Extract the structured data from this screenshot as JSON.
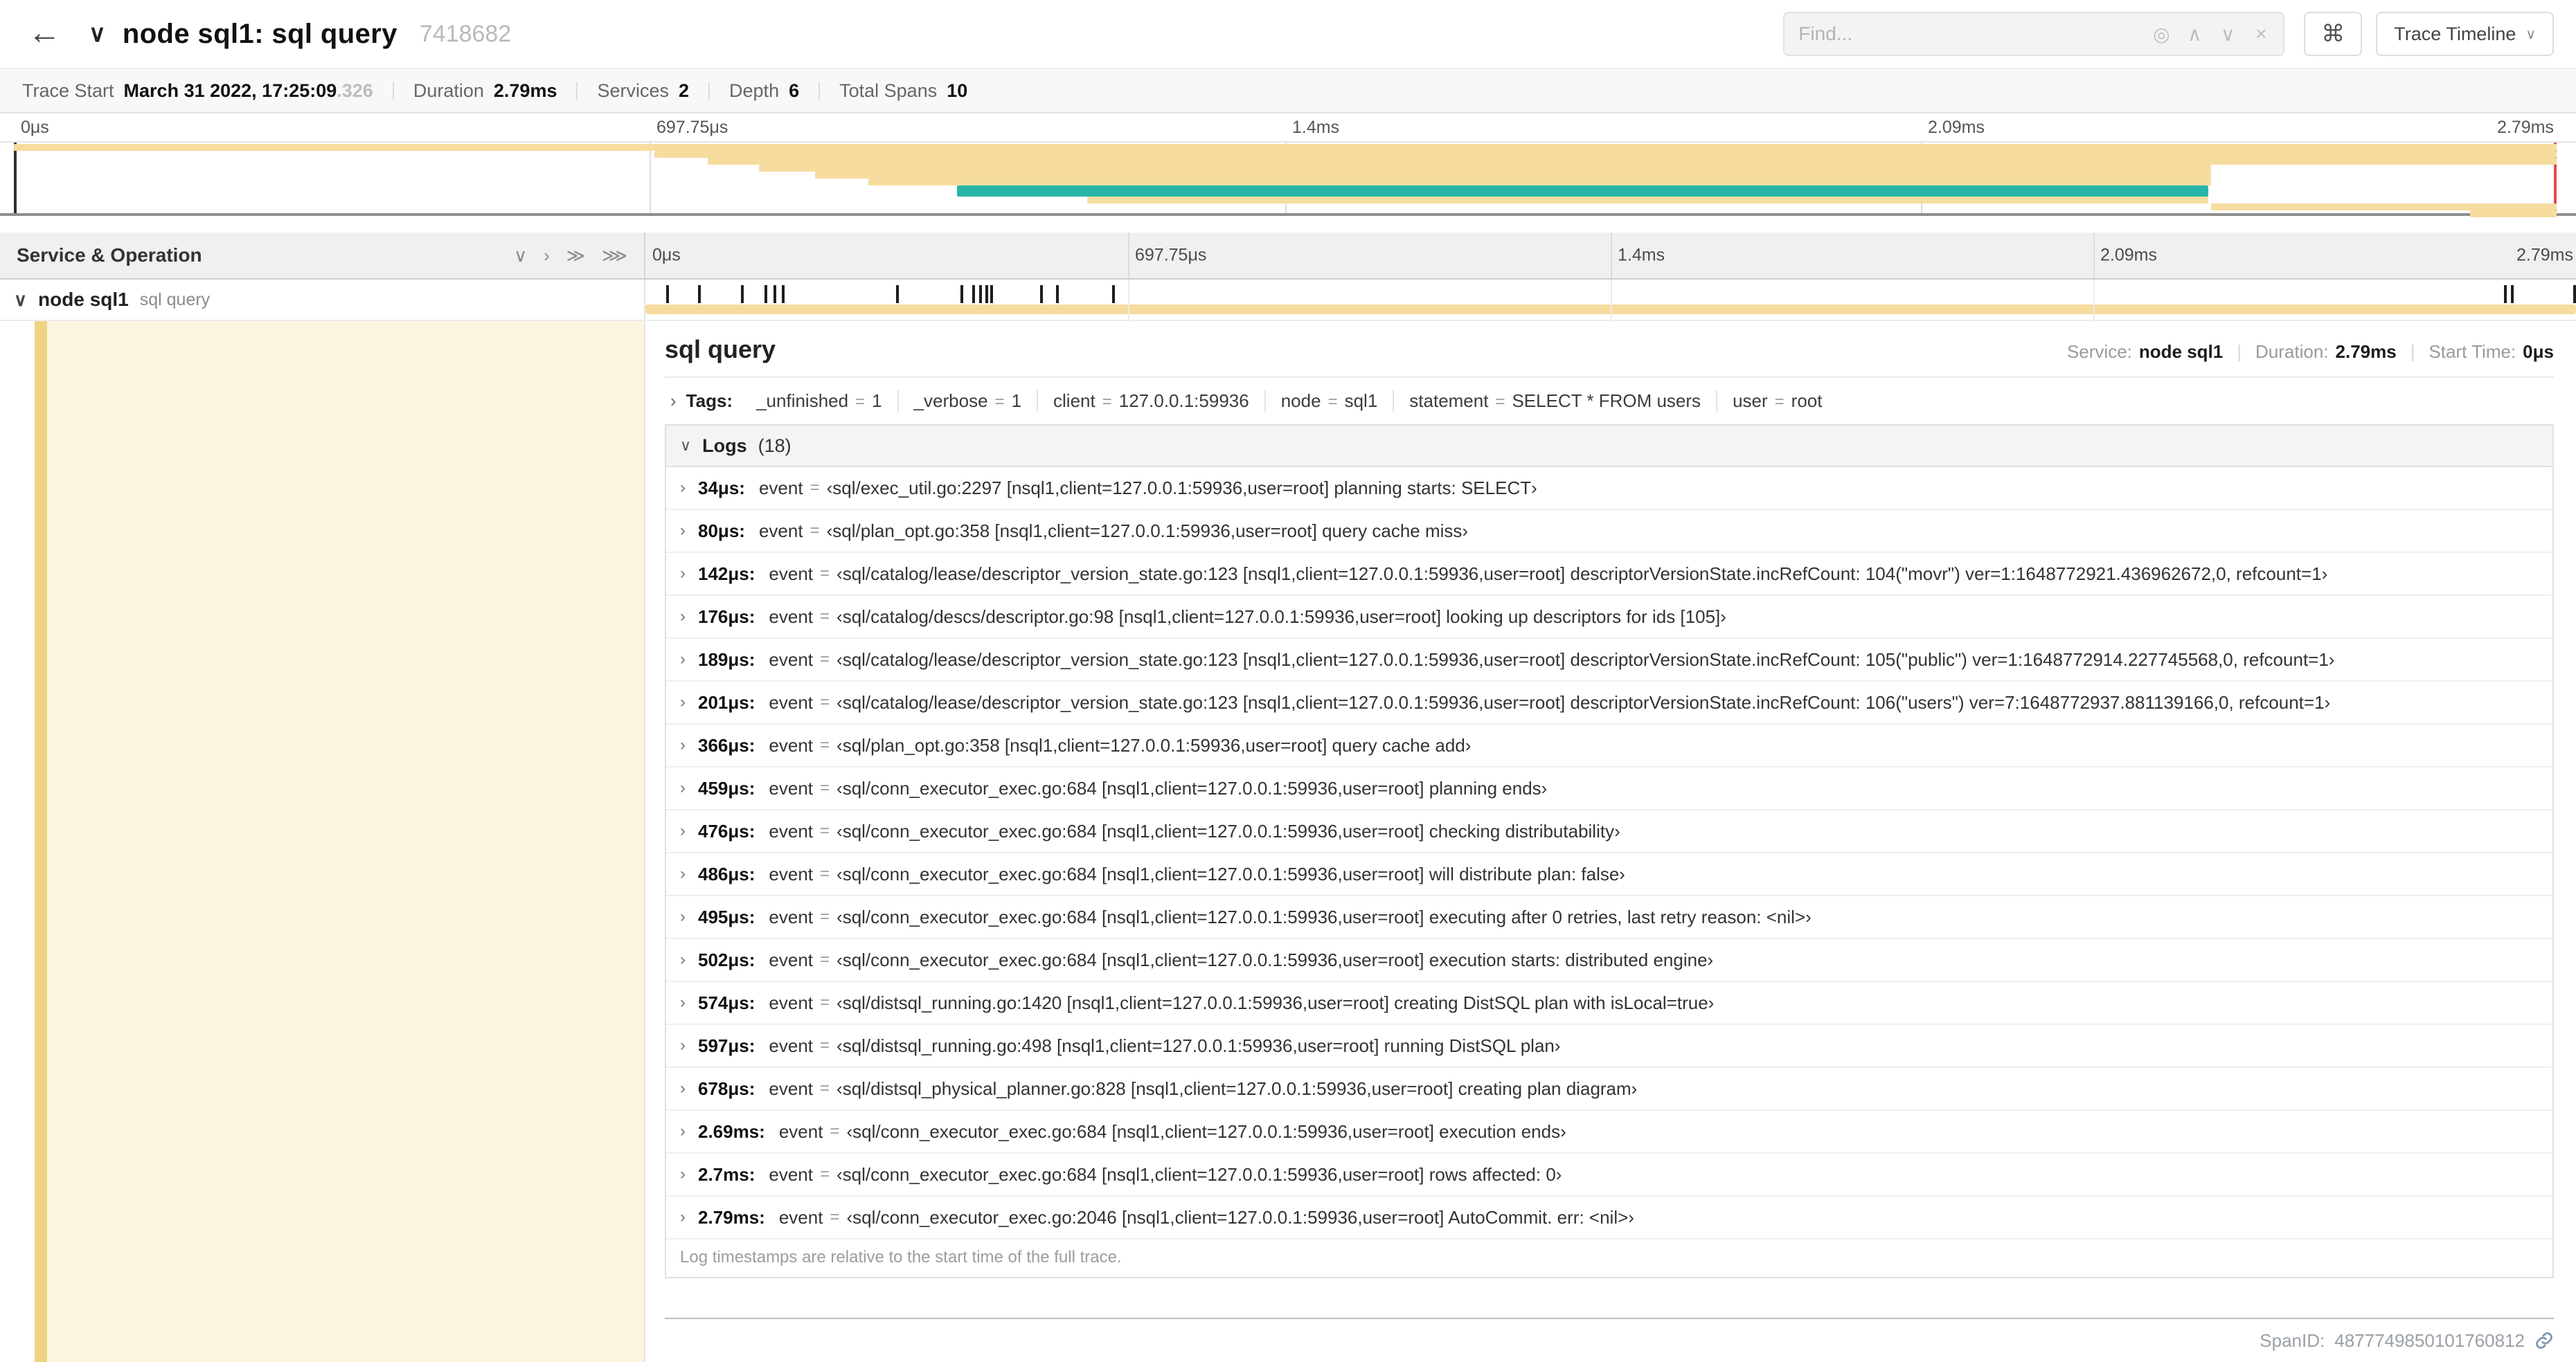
{
  "icons": {
    "back": "←",
    "chevron_down": "∨",
    "chevron_up": "∧",
    "chevron_right": "›",
    "double_chevron_right": "≫",
    "triple_chevron_right": "⋙",
    "locate": "◎",
    "close": "×",
    "command": "⌘"
  },
  "header": {
    "title": "node sql1: sql query",
    "trace_id_short": "7418682",
    "find_placeholder": "Find...",
    "view_button_label": "Trace Timeline"
  },
  "summary": {
    "items": [
      {
        "label": "Trace Start",
        "value": "March 31 2022, 17:25:09",
        "suffix": ".326"
      },
      {
        "label": "Duration",
        "value": "2.79ms"
      },
      {
        "label": "Services",
        "value": "2"
      },
      {
        "label": "Depth",
        "value": "6"
      },
      {
        "label": "Total Spans",
        "value": "10"
      }
    ]
  },
  "minimap": {
    "axis_labels": [
      "0μs",
      "697.75μs",
      "1.4ms",
      "2.09ms",
      "2.79ms"
    ],
    "colors": {
      "tan": "#f7dca0",
      "teal": "#26b5a8",
      "scrubber": "#e5484d"
    },
    "bars": [
      {
        "start": 0,
        "end": 100,
        "color": "tan"
      },
      {
        "start": 25.2,
        "end": 100,
        "color": "tan"
      },
      {
        "start": 27.3,
        "end": 100,
        "color": "tan"
      },
      {
        "start": 29.3,
        "end": 86.4,
        "color": "tan"
      },
      {
        "start": 31.5,
        "end": 86.4,
        "color": "tan"
      },
      {
        "start": 33.6,
        "end": 86.4,
        "color": "tan"
      },
      {
        "start": 37.1,
        "end": 86.3,
        "color": "teal"
      },
      {
        "start": 42.2,
        "end": 86.3,
        "color": "tan"
      },
      {
        "start": 86.4,
        "end": 100,
        "color": "tan"
      },
      {
        "start": 96.6,
        "end": 100,
        "color": "tan"
      }
    ]
  },
  "timeline": {
    "left_header": "Service & Operation",
    "ruler_labels": [
      "0μs",
      "697.75μs",
      "1.4ms",
      "2.09ms",
      "2.79ms"
    ],
    "duration_us": 2790,
    "row": {
      "service": "node sql1",
      "operation": "sql query",
      "bar_start_pct": 0,
      "bar_end_pct": 100
    }
  },
  "detail": {
    "title": "sql query",
    "service_label": "Service:",
    "service_value": "node sql1",
    "duration_label": "Duration:",
    "duration_value": "2.79ms",
    "start_label": "Start Time:",
    "start_value": "0μs",
    "tags_label": "Tags:",
    "tag_eq": "=",
    "tags": [
      {
        "key": "_unfinished",
        "value": "1"
      },
      {
        "key": "_verbose",
        "value": "1"
      },
      {
        "key": "client",
        "value": "127.0.0.1:59936"
      },
      {
        "key": "node",
        "value": "sql1"
      },
      {
        "key": "statement",
        "value": "SELECT * FROM users"
      },
      {
        "key": "user",
        "value": "root"
      }
    ],
    "logs_label": "Logs",
    "logs_count": "(18)",
    "logs": [
      {
        "time": "34μs:",
        "time_us": 34,
        "key": "event",
        "message": "‹sql/exec_util.go:2297 [nsql1,client=127.0.0.1:59936,user=root] planning starts: SELECT›"
      },
      {
        "time": "80μs:",
        "time_us": 80,
        "key": "event",
        "message": "‹sql/plan_opt.go:358 [nsql1,client=127.0.0.1:59936,user=root] query cache miss›"
      },
      {
        "time": "142μs:",
        "time_us": 142,
        "key": "event",
        "message": "‹sql/catalog/lease/descriptor_version_state.go:123 [nsql1,client=127.0.0.1:59936,user=root] descriptorVersionState.incRefCount: 104(\"movr\") ver=1:1648772921.436962672,0, refcount=1›"
      },
      {
        "time": "176μs:",
        "time_us": 176,
        "key": "event",
        "message": "‹sql/catalog/descs/descriptor.go:98 [nsql1,client=127.0.0.1:59936,user=root] looking up descriptors for ids [105]›"
      },
      {
        "time": "189μs:",
        "time_us": 189,
        "key": "event",
        "message": "‹sql/catalog/lease/descriptor_version_state.go:123 [nsql1,client=127.0.0.1:59936,user=root] descriptorVersionState.incRefCount: 105(\"public\") ver=1:1648772914.227745568,0, refcount=1›"
      },
      {
        "time": "201μs:",
        "time_us": 201,
        "key": "event",
        "message": "‹sql/catalog/lease/descriptor_version_state.go:123 [nsql1,client=127.0.0.1:59936,user=root] descriptorVersionState.incRefCount: 106(\"users\") ver=7:1648772937.881139166,0, refcount=1›"
      },
      {
        "time": "366μs:",
        "time_us": 366,
        "key": "event",
        "message": "‹sql/plan_opt.go:358 [nsql1,client=127.0.0.1:59936,user=root] query cache add›"
      },
      {
        "time": "459μs:",
        "time_us": 459,
        "key": "event",
        "message": "‹sql/conn_executor_exec.go:684 [nsql1,client=127.0.0.1:59936,user=root] planning ends›"
      },
      {
        "time": "476μs:",
        "time_us": 476,
        "key": "event",
        "message": "‹sql/conn_executor_exec.go:684 [nsql1,client=127.0.0.1:59936,user=root] checking distributability›"
      },
      {
        "time": "486μs:",
        "time_us": 486,
        "key": "event",
        "message": "‹sql/conn_executor_exec.go:684 [nsql1,client=127.0.0.1:59936,user=root] will distribute plan: false›"
      },
      {
        "time": "495μs:",
        "time_us": 495,
        "key": "event",
        "message": "‹sql/conn_executor_exec.go:684 [nsql1,client=127.0.0.1:59936,user=root] executing after 0 retries, last retry reason: <nil>›"
      },
      {
        "time": "502μs:",
        "time_us": 502,
        "key": "event",
        "message": "‹sql/conn_executor_exec.go:684 [nsql1,client=127.0.0.1:59936,user=root] execution starts: distributed engine›"
      },
      {
        "time": "574μs:",
        "time_us": 574,
        "key": "event",
        "message": "‹sql/distsql_running.go:1420 [nsql1,client=127.0.0.1:59936,user=root] creating DistSQL plan with isLocal=true›"
      },
      {
        "time": "597μs:",
        "time_us": 597,
        "key": "event",
        "message": "‹sql/distsql_running.go:498 [nsql1,client=127.0.0.1:59936,user=root] running DistSQL plan›"
      },
      {
        "time": "678μs:",
        "time_us": 678,
        "key": "event",
        "message": "‹sql/distsql_physical_planner.go:828 [nsql1,client=127.0.0.1:59936,user=root] creating plan diagram›"
      },
      {
        "time": "2.69ms:",
        "time_us": 2690,
        "key": "event",
        "message": "‹sql/conn_executor_exec.go:684 [nsql1,client=127.0.0.1:59936,user=root] execution ends›"
      },
      {
        "time": "2.7ms:",
        "time_us": 2700,
        "key": "event",
        "message": "‹sql/conn_executor_exec.go:684 [nsql1,client=127.0.0.1:59936,user=root] rows affected: 0›"
      },
      {
        "time": "2.79ms:",
        "time_us": 2790,
        "key": "event",
        "message": "‹sql/conn_executor_exec.go:2046 [nsql1,client=127.0.0.1:59936,user=root] AutoCommit. err: <nil>›"
      }
    ],
    "logs_note": "Log timestamps are relative to the start time of the full trace.",
    "span_id_label": "SpanID:",
    "span_id": "4877749850101760812"
  }
}
